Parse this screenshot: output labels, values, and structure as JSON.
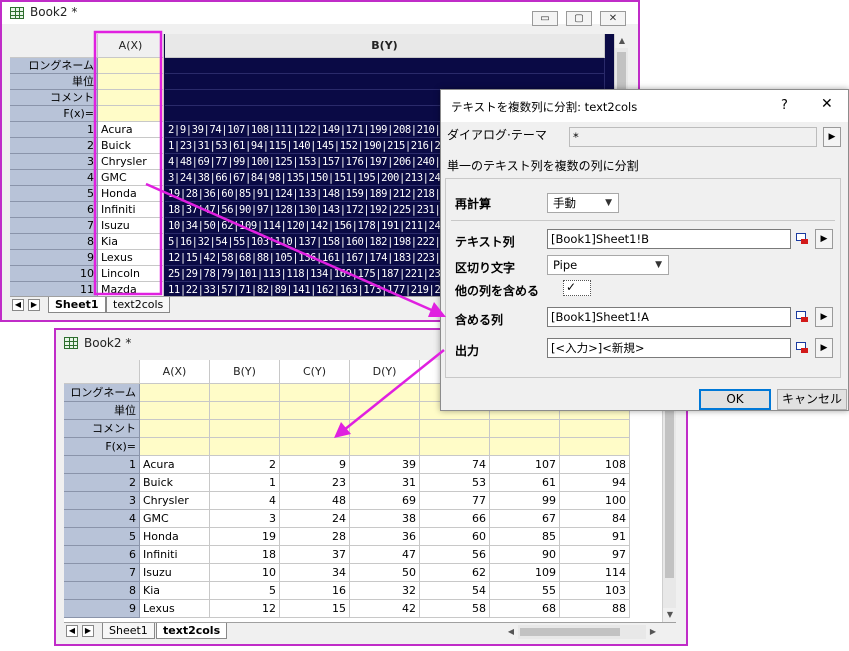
{
  "top_window": {
    "title": "Book2 *",
    "columns": [
      "A(X)",
      "B(Y)"
    ],
    "meta_rows": [
      "ロングネーム",
      "単位",
      "コメント",
      "F(x)="
    ],
    "rows": [
      {
        "n": "1",
        "a": "Acura",
        "b": "2|9|39|74|107|108|111|122|149|171|199|208|210|2"
      },
      {
        "n": "2",
        "a": "Buick",
        "b": "1|23|31|53|61|94|115|140|145|152|190|215|216|24"
      },
      {
        "n": "3",
        "a": "Chrysler",
        "b": "4|48|69|77|99|100|125|153|157|176|197|206|240|2"
      },
      {
        "n": "4",
        "a": "GMC",
        "b": "3|24|38|66|67|84|98|135|150|151|195|200|213|244"
      },
      {
        "n": "5",
        "a": "Honda",
        "b": "19|28|36|60|85|91|124|133|148|159|189|212|218|2"
      },
      {
        "n": "6",
        "a": "Infiniti",
        "b": "18|37|47|56|90|97|128|130|143|172|192|225|231|2"
      },
      {
        "n": "7",
        "a": "Isuzu",
        "b": "10|34|50|62|109|114|120|142|156|178|191|211|24"
      },
      {
        "n": "8",
        "a": "Kia",
        "b": "5|16|32|54|55|103|110|137|158|160|182|198|222|2"
      },
      {
        "n": "9",
        "a": "Lexus",
        "b": "12|15|42|58|68|88|105|136|161|167|174|183|223|2"
      },
      {
        "n": "10",
        "a": "Lincoln",
        "b": "25|29|78|79|101|113|118|134|169|175|187|221|23"
      },
      {
        "n": "11",
        "a": "Mazda",
        "b": "11|22|33|57|71|82|89|141|162|163|173|177|219|24"
      }
    ],
    "tabs": [
      "Sheet1",
      "text2cols"
    ],
    "window_buttons": [
      "▭",
      "▢",
      "✕"
    ]
  },
  "dialog": {
    "title": "テキストを複数列に分割: text2cols",
    "help": "?",
    "close": "✕",
    "theme_label": "ダイアログ·テーマ",
    "theme_value": "*",
    "description": "単一のテキスト列を複数の列に分割",
    "recalc_label": "再計算",
    "recalc_value": "手動",
    "text_col_label": "テキスト列",
    "text_col_value": "[Book1]Sheet1!B",
    "delimiter_label": "区切り文字",
    "delimiter_value": "Pipe",
    "include_other_label": "他の列を含める",
    "include_other_checked": "✓",
    "include_col_label": "含める列",
    "include_col_value": "[Book1]Sheet1!A",
    "output_label": "出力",
    "output_value": "[<入力>]<新規>",
    "ok": "OK",
    "cancel": "キャンセル"
  },
  "bottom_window": {
    "title": "Book2 *",
    "columns": [
      "A(X)",
      "B(Y)",
      "C(Y)",
      "D(Y)"
    ],
    "meta_rows": [
      "ロングネーム",
      "単位",
      "コメント",
      "F(x)="
    ],
    "rows": [
      {
        "n": "1",
        "a": "Acura",
        "v": [
          "2",
          "9",
          "39",
          "74",
          "107",
          "108"
        ]
      },
      {
        "n": "2",
        "a": "Buick",
        "v": [
          "1",
          "23",
          "31",
          "53",
          "61",
          "94"
        ]
      },
      {
        "n": "3",
        "a": "Chrysler",
        "v": [
          "4",
          "48",
          "69",
          "77",
          "99",
          "100"
        ]
      },
      {
        "n": "4",
        "a": "GMC",
        "v": [
          "3",
          "24",
          "38",
          "66",
          "67",
          "84"
        ]
      },
      {
        "n": "5",
        "a": "Honda",
        "v": [
          "19",
          "28",
          "36",
          "60",
          "85",
          "91"
        ]
      },
      {
        "n": "6",
        "a": "Infiniti",
        "v": [
          "18",
          "37",
          "47",
          "56",
          "90",
          "97"
        ]
      },
      {
        "n": "7",
        "a": "Isuzu",
        "v": [
          "10",
          "34",
          "50",
          "62",
          "109",
          "114"
        ]
      },
      {
        "n": "8",
        "a": "Kia",
        "v": [
          "5",
          "16",
          "32",
          "54",
          "55",
          "103"
        ]
      },
      {
        "n": "9",
        "a": "Lexus",
        "v": [
          "12",
          "15",
          "42",
          "58",
          "68",
          "88"
        ]
      }
    ],
    "tabs": [
      "Sheet1",
      "text2cols"
    ]
  },
  "colors": {
    "annotation": "#e020e0",
    "window_border": "#c02cc8",
    "dark_column": "#0a0a45",
    "meta_fill": "#fffcc8",
    "row_header": "#b8c3d8"
  }
}
